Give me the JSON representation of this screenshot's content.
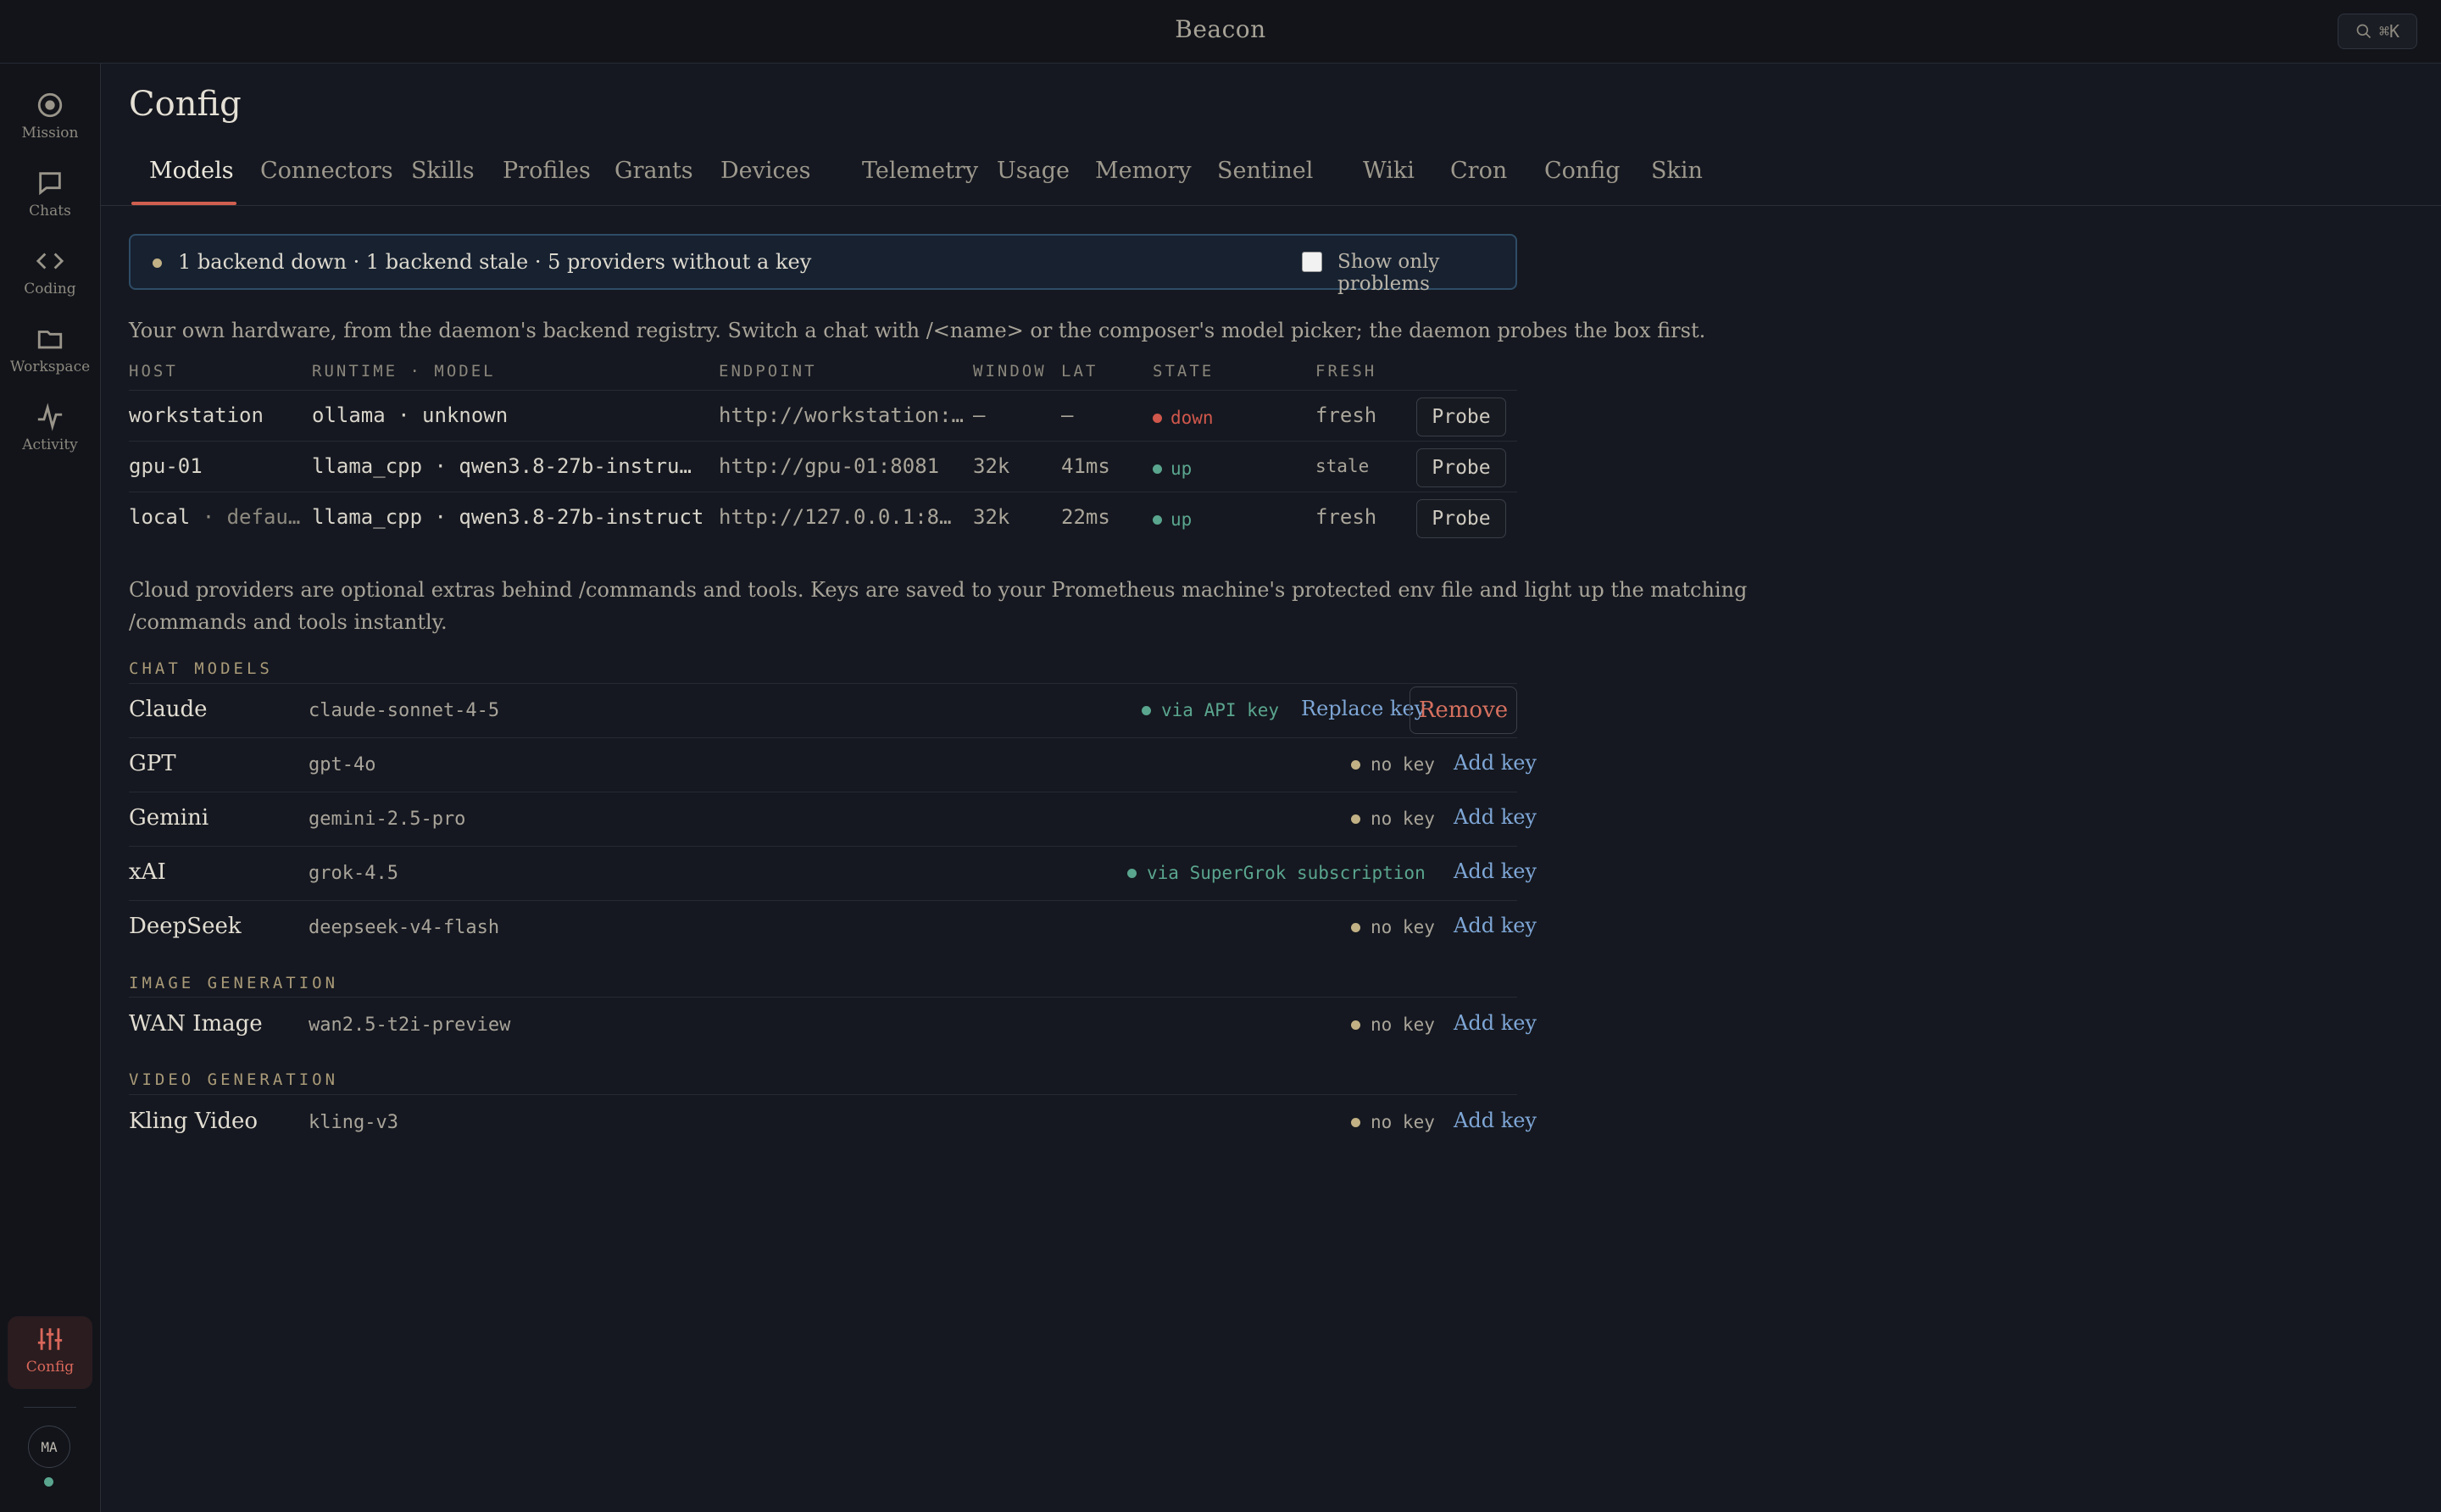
{
  "app": {
    "title": "Beacon",
    "search_shortcut": "⌘K"
  },
  "sidebar": {
    "items": [
      {
        "label": "Mission",
        "icon": "target-icon"
      },
      {
        "label": "Chats",
        "icon": "chat-bubble-icon"
      },
      {
        "label": "Coding",
        "icon": "code-icon"
      },
      {
        "label": "Workspace",
        "icon": "folder-icon"
      },
      {
        "label": "Activity",
        "icon": "activity-pulse-icon"
      }
    ],
    "active": {
      "label": "Config",
      "icon": "sliders-icon"
    },
    "avatar_initials": "MA"
  },
  "page": {
    "title": "Config"
  },
  "tabs": [
    "Models",
    "Connectors",
    "Skills",
    "Profiles",
    "Grants",
    "Devices",
    "Telemetry",
    "Usage",
    "Memory",
    "Sentinel",
    "Wiki",
    "Cron",
    "Config",
    "Skin"
  ],
  "active_tab": "Models",
  "banner": {
    "message": "1 backend down · 1 backend stale · 5 providers without a key",
    "checkbox_label": "Show only problems",
    "checked": false
  },
  "backends": {
    "description": "Your own hardware, from the daemon's backend registry. Switch a chat with /<name> or the composer's model picker; the daemon probes the box first.",
    "columns": [
      "HOST",
      "RUNTIME · MODEL",
      "ENDPOINT",
      "WINDOW",
      "LAT",
      "STATE",
      "FRESH"
    ],
    "rows": [
      {
        "host": "workstation",
        "host_suffix": "",
        "runtime": "ollama · unknown",
        "endpoint": "http://workstation:…",
        "window": "—",
        "lat": "—",
        "state": "down",
        "fresh": "fresh",
        "action": "Probe"
      },
      {
        "host": "gpu-01",
        "host_suffix": "",
        "runtime": "llama_cpp · qwen3.8-27b-instruct…",
        "endpoint": "http://gpu-01:8081",
        "window": "32k",
        "lat": "41ms",
        "state": "up",
        "fresh": "stale",
        "action": "Probe"
      },
      {
        "host": "local",
        "host_suffix": "· defau…",
        "runtime": "llama_cpp · qwen3.8-27b-instruct",
        "endpoint": "http://127.0.0.1:80…",
        "window": "32k",
        "lat": "22ms",
        "state": "up",
        "fresh": "fresh",
        "action": "Probe"
      }
    ]
  },
  "cloud": {
    "description_line1": "Cloud providers are optional extras behind /commands and tools. Keys are saved to your Prometheus machine's protected env file and light up the matching",
    "description_line2": "/commands and tools instantly.",
    "sections": {
      "chat": "CHAT MODELS",
      "image": "IMAGE GENERATION",
      "video": "VIDEO GENERATION"
    },
    "providers": [
      {
        "name": "Claude",
        "model": "claude-sonnet-4-5",
        "status": "via API key",
        "action": "Replace key",
        "secondary_action": "Remove"
      },
      {
        "name": "GPT",
        "model": "gpt-4o",
        "status": "no key",
        "action": "Add key"
      },
      {
        "name": "Gemini",
        "model": "gemini-2.5-pro",
        "status": "no key",
        "action": "Add key"
      },
      {
        "name": "xAI",
        "model": "grok-4.5",
        "status": "via SuperGrok subscription",
        "action": "Add key"
      },
      {
        "name": "DeepSeek",
        "model": "deepseek-v4-flash",
        "status": "no key",
        "action": "Add key"
      },
      {
        "name": "WAN Image",
        "model": "wan2.5-t2i-preview",
        "status": "no key",
        "action": "Add key"
      },
      {
        "name": "Kling Video",
        "model": "kling-v3",
        "status": "no key",
        "action": "Add key"
      }
    ]
  },
  "colors": {
    "accent": "#d05f50",
    "down": "#d0574c",
    "up": "#5aa58e",
    "warn": "#c2b185",
    "link": "#7ea6d6"
  }
}
